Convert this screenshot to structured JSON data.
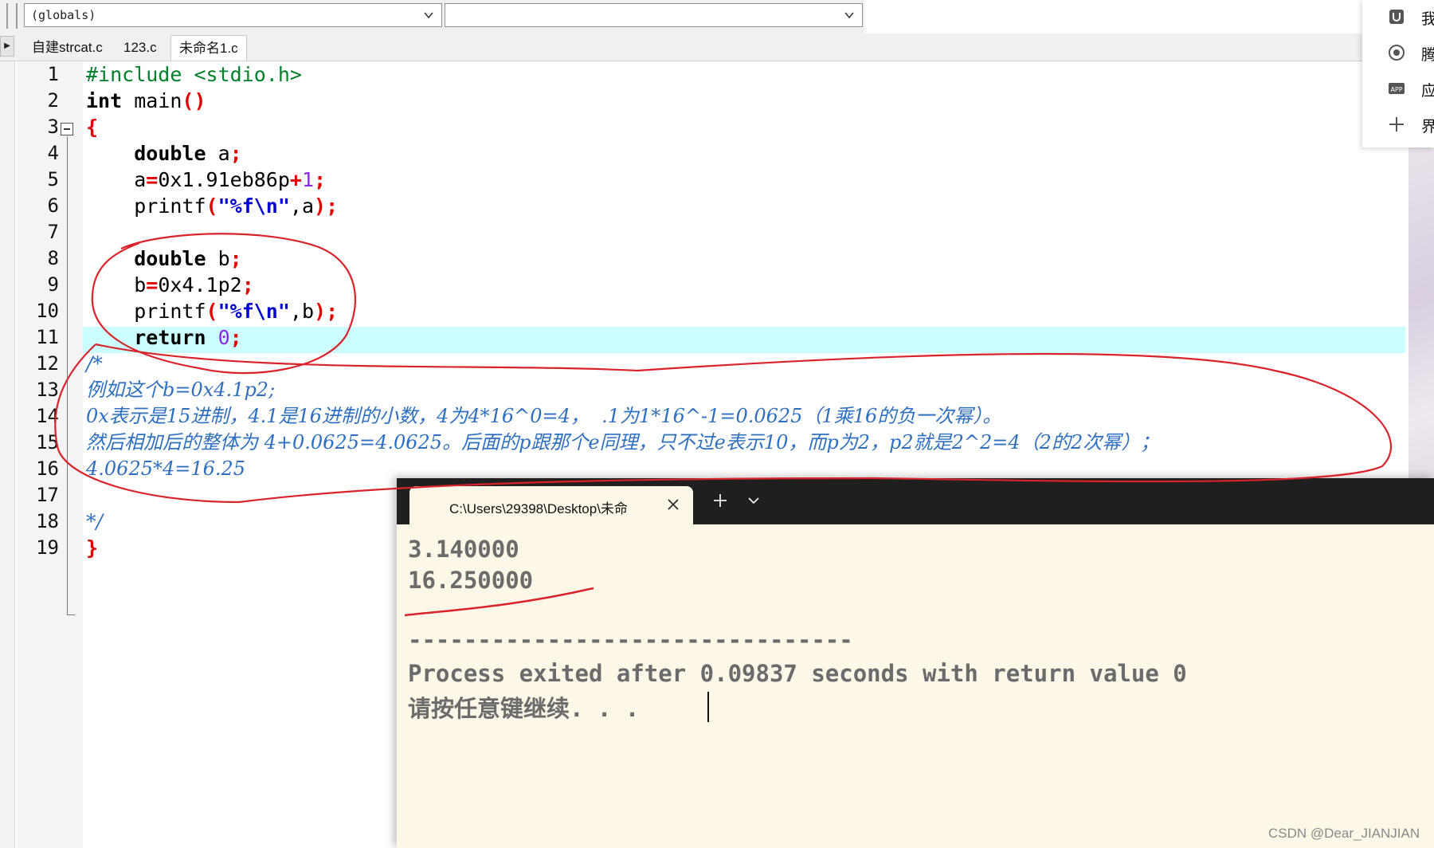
{
  "toolbar": {
    "scope_combo": "(globals)",
    "member_combo": ""
  },
  "tabs": [
    {
      "label": "自建strcat.c",
      "active": false
    },
    {
      "label": "123.c",
      "active": false
    },
    {
      "label": "未命名1.c",
      "active": true
    }
  ],
  "editor": {
    "line_numbers": [
      "1",
      "2",
      "3",
      "4",
      "5",
      "6",
      "7",
      "8",
      "9",
      "10",
      "11",
      "12",
      "13",
      "14",
      "15",
      "16",
      "17",
      "18",
      "19"
    ],
    "lines": {
      "l1": "#include <stdio.h>",
      "l2_kw": "int",
      "l2_rest": " main",
      "l2_sym": "()",
      "l3": "{",
      "l4_kw": "double",
      "l4_rest": " a",
      "l4_sym": ";",
      "l5_a": "a",
      "l5_eq": "=",
      "l5_num": "0x1.91eb86p",
      "l5_plus": "+",
      "l5_one": "1",
      "l5_semi": ";",
      "l6_fn": "printf",
      "l6_lp": "(",
      "l6_str": "\"%f\\n\"",
      "l6_rest": ",a",
      "l6_end": ");",
      "l8_kw": "double",
      "l8_rest": " b",
      "l8_sym": ";",
      "l9_b": "b",
      "l9_eq": "=",
      "l9_num": "0x4.1p2",
      "l9_semi": ";",
      "l10_fn": "printf",
      "l10_lp": "(",
      "l10_str": "\"%f\\n\"",
      "l10_rest": ",b",
      "l10_end": ");",
      "l11_kw": "return",
      "l11_num": " 0",
      "l11_semi": ";",
      "l12": "/*",
      "l13": "例如这个b=0x4.1p2;",
      "l14": "0x表示是15进制，4.1是16进制的小数，4为4*16^0=4，  .1为1*16^-1=0.0625（1乘16的负一次幂）。",
      "l15": "然后相加后的整体为 4+0.0625=4.0625。后面的p跟那个e同理，只不过e表示10，而p为2，p2就是2^2=4（2的2次幂）；",
      "l16": "4.0625*4=16.25",
      "l18": "*/",
      "l19": "}"
    }
  },
  "side_panel": {
    "items": [
      {
        "label": "我的",
        "icon": "u-box-icon"
      },
      {
        "label": "腾讯",
        "icon": "refresh-circle-icon"
      },
      {
        "label": "应用",
        "icon": "app-icon"
      },
      {
        "label": "界面",
        "icon": "plus-icon"
      }
    ]
  },
  "terminal": {
    "tab_title": "C:\\Users\\29398\\Desktop\\未命",
    "output": [
      "3.140000",
      "16.250000",
      "",
      "--------------------------------",
      "Process exited after 0.09837 seconds with return value 0",
      "请按任意键继续. . ."
    ]
  },
  "watermark": "CSDN @Dear_JIANJIAN",
  "colors": {
    "highlight_line": "#ccffff",
    "comment": "#2f6fc0",
    "annotation": "#d9232a",
    "terminal_bg": "#fdf7e7"
  }
}
